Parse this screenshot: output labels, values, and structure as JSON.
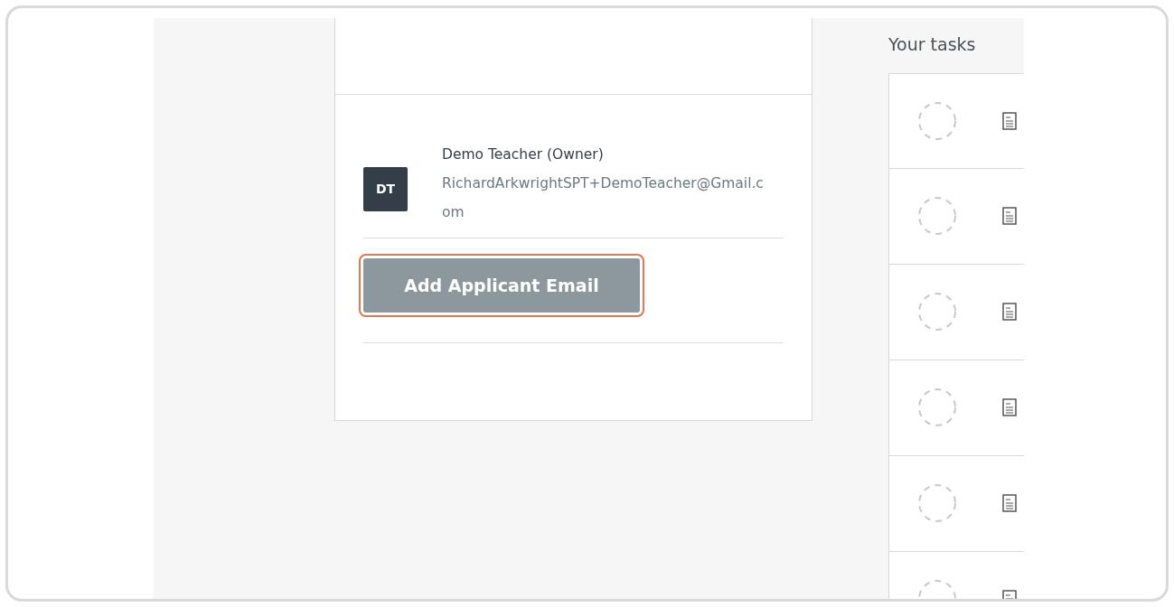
{
  "members": [
    {
      "initials": "DT",
      "name": "Demo Teacher (Owner)",
      "email": "RichardArkwrightSPT+DemoTeacher@Gmail.com"
    }
  ],
  "add_button": {
    "label": "Add Applicant Email",
    "highlighted": true
  },
  "tasks": {
    "title": "Your tasks",
    "items": [
      {
        "completed": false
      },
      {
        "completed": false
      },
      {
        "completed": false
      },
      {
        "completed": false
      },
      {
        "completed": false
      },
      {
        "completed": false
      }
    ]
  }
}
